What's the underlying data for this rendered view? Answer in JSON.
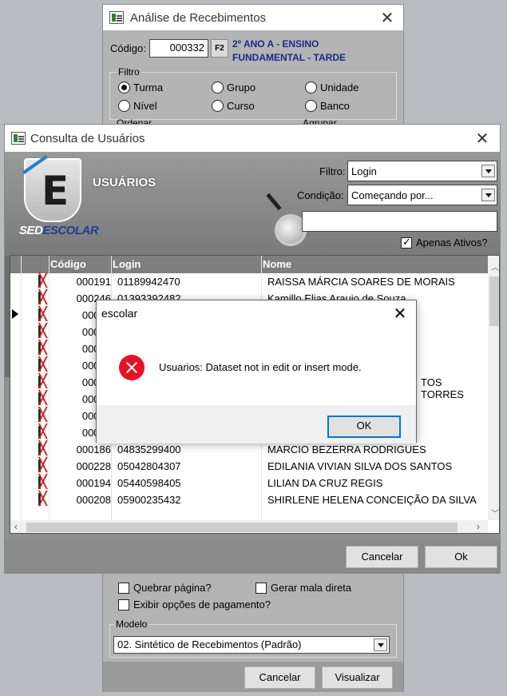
{
  "back_window": {
    "title": "Análise de Recebimentos",
    "codigo_label": "Código:",
    "codigo_value": "000332",
    "f2_label": "F2",
    "turma_desc_1": "2º ANO A - ENSINO",
    "turma_desc_2": "FUNDAMENTAL - TARDE",
    "filtro_label": "Filtro",
    "radios": [
      "Turma",
      "Grupo",
      "Unidade",
      "Nível",
      "Curso",
      "Banco"
    ],
    "ordenar_label": "Ordenar",
    "agrupar_label": "Agrupar",
    "quebrar_label": "Quebrar página?",
    "mala_label": "Gerar mala direta",
    "exibir_label": "Exibir opções de pagamento?",
    "modelo_label": "Modelo",
    "modelo_value": "02. Sintético de Recebimentos (Padrão)",
    "cancelar": "Cancelar",
    "visualizar": "Visualizar"
  },
  "mid_window": {
    "title": "Consulta de Usuários",
    "header_title": "USUÁRIOS",
    "logo_part1": "SED",
    "logo_part2": "ESCOLAR",
    "filtro_label": "Filtro:",
    "filtro_value": "Login",
    "condicao_label": "Condição:",
    "condicao_value": "Começando por...",
    "search_value": "",
    "apenas_ativos": "Apenas Ativos?",
    "columns": {
      "codigo": "Código",
      "login": "Login",
      "nome": "Nome"
    },
    "rows": [
      {
        "code": "000191",
        "login": "01189942470",
        "name": "RAISSA MÁRCIA SOARES DE MORAIS"
      },
      {
        "code": "000246",
        "login": "01393392482",
        "name": "Kamillo Elias Araujo de Souza"
      },
      {
        "code": "00022",
        "login": "",
        "name": ""
      },
      {
        "code": "00023",
        "login": "",
        "name": ""
      },
      {
        "code": "00022",
        "login": "",
        "name": ""
      },
      {
        "code": "00021",
        "login": "",
        "name": ""
      },
      {
        "code": "00022",
        "login": "",
        "name": "TOS TORRES"
      },
      {
        "code": "00024",
        "login": "",
        "name": ""
      },
      {
        "code": "00019",
        "login": "",
        "name": ""
      },
      {
        "code": "00021",
        "login": "",
        "name": ""
      },
      {
        "code": "000186",
        "login": "04835299400",
        "name": "MARCIO BEZERRA RODRIGUES"
      },
      {
        "code": "000228",
        "login": "05042804307",
        "name": "EDILANIA VIVIAN SILVA DOS SANTOS"
      },
      {
        "code": "000194",
        "login": "05440598405",
        "name": "LILIAN DA CRUZ REGIS"
      },
      {
        "code": "000208",
        "login": "05900235432",
        "name": "SHIRLENE HELENA CONCEIÇÃO DA SILVA"
      }
    ],
    "cancelar": "Cancelar",
    "ok": "Ok"
  },
  "dialog": {
    "title": "escolar",
    "message": "Usuarios: Dataset not in edit or insert mode.",
    "ok": "OK"
  }
}
